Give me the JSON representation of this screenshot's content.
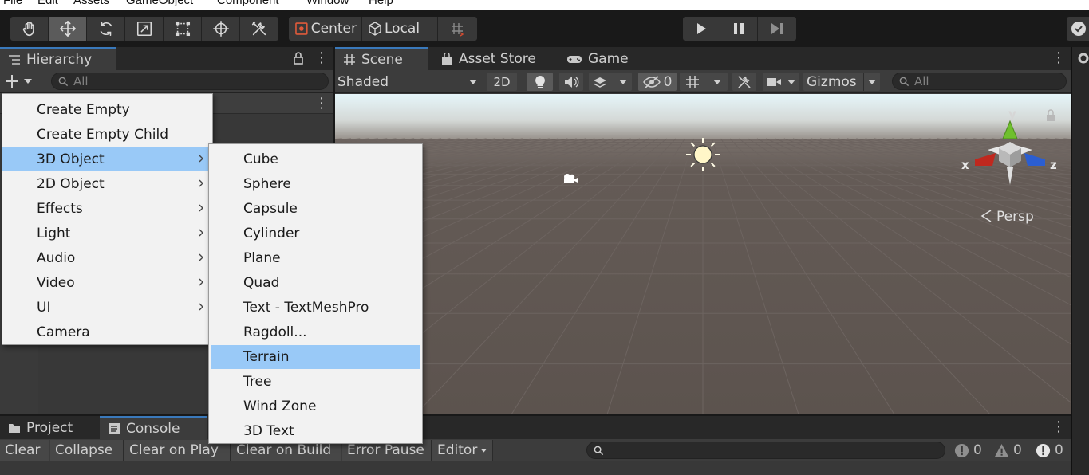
{
  "menubar": {
    "items": [
      "File",
      "Edit",
      "Assets",
      "GameObject",
      "Component",
      "Window",
      "Help"
    ]
  },
  "toolbar": {
    "tools": [
      {
        "name": "hand-tool",
        "icon": "hand-icon"
      },
      {
        "name": "move-tool",
        "icon": "move-icon",
        "active": true
      },
      {
        "name": "rotate-tool",
        "icon": "rotate-icon"
      },
      {
        "name": "scale-tool",
        "icon": "scale-icon"
      },
      {
        "name": "rect-tool",
        "icon": "rect-icon"
      },
      {
        "name": "transform-tool",
        "icon": "transform-icon"
      },
      {
        "name": "custom-tool",
        "icon": "tools-icon"
      }
    ],
    "pivot_label": "Center",
    "space_label": "Local"
  },
  "hierarchy": {
    "tab_label": "Hierarchy",
    "search_placeholder": "All"
  },
  "scene": {
    "tabs": [
      "Scene",
      "Asset Store",
      "Game"
    ],
    "shading_mode": "Shaded",
    "mode_2d": "2D",
    "hidden_count": "0",
    "gizmos_label": "Gizmos",
    "search_placeholder": "All",
    "persp_label": "Persp",
    "axis_x": "x",
    "axis_y": "y",
    "axis_z": "z"
  },
  "console": {
    "tabs": [
      "Project",
      "Console"
    ],
    "buttons": {
      "clear": "Clear",
      "collapse": "Collapse",
      "clear_on_play": "Clear on Play",
      "clear_on_build": "Clear on Build",
      "error_pause": "Error Pause",
      "editor": "Editor"
    },
    "counts": {
      "errors": "0",
      "warnings": "0",
      "messages": "0"
    }
  },
  "create_menu": {
    "items": [
      {
        "label": "Create Empty",
        "submenu": false
      },
      {
        "label": "Create Empty Child",
        "submenu": false
      },
      {
        "label": "3D Object",
        "submenu": true,
        "highlighted": true
      },
      {
        "label": "2D Object",
        "submenu": true
      },
      {
        "label": "Effects",
        "submenu": true
      },
      {
        "label": "Light",
        "submenu": true
      },
      {
        "label": "Audio",
        "submenu": true
      },
      {
        "label": "Video",
        "submenu": true
      },
      {
        "label": "UI",
        "submenu": true
      },
      {
        "label": "Camera",
        "submenu": false
      }
    ]
  },
  "object3d_menu": {
    "items": [
      {
        "label": "Cube"
      },
      {
        "label": "Sphere"
      },
      {
        "label": "Capsule"
      },
      {
        "label": "Cylinder"
      },
      {
        "label": "Plane"
      },
      {
        "label": "Quad"
      },
      {
        "label": "Text - TextMeshPro"
      },
      {
        "label": "Ragdoll..."
      },
      {
        "label": "Terrain",
        "highlighted": true
      },
      {
        "label": "Tree"
      },
      {
        "label": "Wind Zone"
      },
      {
        "label": "3D Text"
      }
    ]
  },
  "colors": {
    "menu_highlight": "#99c9f7",
    "ground": "#5f5651",
    "sky": "#e6f2f6",
    "axis_x": "#c0281e",
    "axis_y": "#6fbf2d",
    "axis_z": "#2b5ed1"
  }
}
